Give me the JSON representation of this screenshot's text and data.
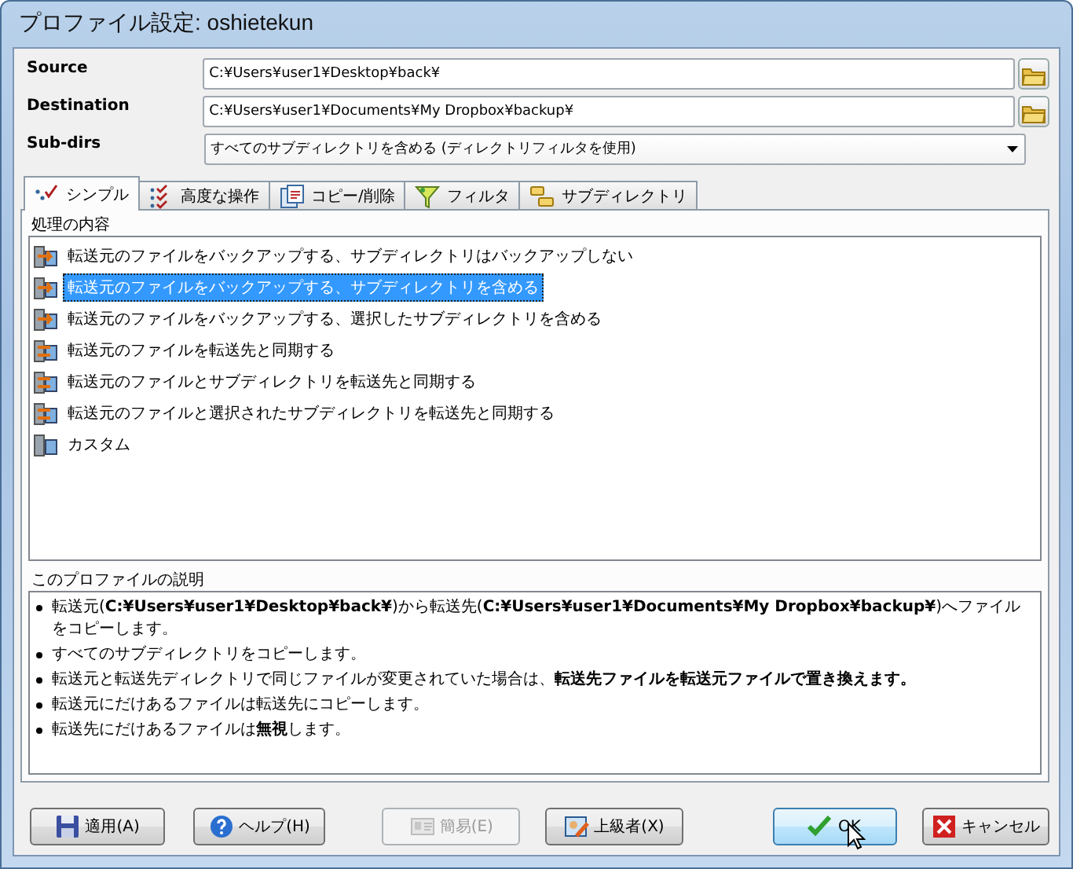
{
  "window": {
    "title": "プロファイル設定: oshietekun"
  },
  "fields": [
    {
      "label": "Source",
      "kind": "path",
      "value": "C:¥Users¥user1¥Desktop¥back¥"
    },
    {
      "label": "Destination",
      "kind": "path",
      "value": "C:¥Users¥user1¥Documents¥My Dropbox¥backup¥"
    },
    {
      "label": "Sub-dirs",
      "kind": "dropdown",
      "value": "すべてのサブディレクトリを含める (ディレクトリフィルタを使用)"
    }
  ],
  "tabs": [
    {
      "label": "シンプル",
      "selected": true
    },
    {
      "label": "高度な操作",
      "selected": false
    },
    {
      "label": "コピー/削除",
      "selected": false
    },
    {
      "label": "フィルタ",
      "selected": false
    },
    {
      "label": "サブディレクトリ",
      "selected": false
    }
  ],
  "operations": {
    "title": "処理の内容",
    "items": [
      {
        "label": "転送元のファイルをバックアップする、サブディレクトリはバックアップしない",
        "kind": "backup",
        "selected": false
      },
      {
        "label": "転送元のファイルをバックアップする、サブディレクトリを含める",
        "kind": "backup",
        "selected": true
      },
      {
        "label": "転送元のファイルをバックアップする、選択したサブディレクトリを含める",
        "kind": "backup",
        "selected": false
      },
      {
        "label": "転送元のファイルを転送先と同期する",
        "kind": "sync",
        "selected": false
      },
      {
        "label": "転送元のファイルとサブディレクトリを転送先と同期する",
        "kind": "sync",
        "selected": false
      },
      {
        "label": "転送元のファイルと選択されたサブディレクトリを転送先と同期する",
        "kind": "sync",
        "selected": false
      },
      {
        "label": "カスタム",
        "kind": "custom",
        "selected": false
      }
    ]
  },
  "description": {
    "title": "このプロファイルの説明",
    "items": [
      "転送元(**C:¥Users¥user1¥Desktop¥back¥**)から転送先(**C:¥Users¥user1¥Documents¥My Dropbox¥backup¥**)へファイルをコピーします。",
      "すべてのサブディレクトリをコピーします。",
      "転送元と転送先ディレクトリで同じファイルが変更されていた場合は、**転送先ファイルを転送元ファイルで置き換えます。**",
      "転送元にだけあるファイルは転送先にコピーします。",
      "転送先にだけあるファイルは**無視**します。"
    ]
  },
  "buttons": [
    {
      "label": "適用(A)",
      "kind": "apply",
      "disabled": false,
      "default": false
    },
    {
      "label": "ヘルプ(H)",
      "kind": "help",
      "disabled": false,
      "default": false
    },
    {
      "label": "簡易(E)",
      "kind": "simple",
      "disabled": true,
      "default": false
    },
    {
      "label": "上級者(X)",
      "kind": "advanced",
      "disabled": false,
      "default": false
    },
    {
      "label": "OK",
      "kind": "ok",
      "disabled": false,
      "default": true
    },
    {
      "label": "キャンセル",
      "kind": "cancel",
      "disabled": false,
      "default": false
    }
  ]
}
